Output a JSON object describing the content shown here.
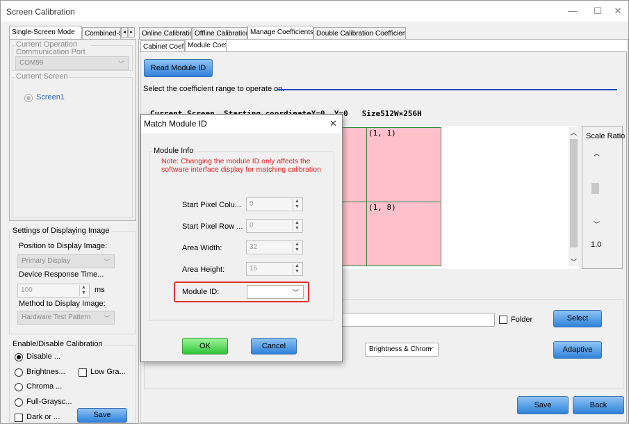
{
  "window": {
    "title": "Screen Calibration",
    "minimize": "—",
    "maximize": "☐",
    "close": "✕"
  },
  "left_tabs": [
    "Single-Screen Mode",
    "Combined-Sc"
  ],
  "left_tab_scroll": {
    "left": "◂",
    "right": "▸"
  },
  "left": {
    "comm_group_title": "Current Operation Communication Port",
    "comm_port": "COM99",
    "screen_group_title": "Current Screen",
    "screen_radio": "Screen1",
    "display_group_title": "Settings of Displaying Image",
    "position_label": "Position to Display Image:",
    "position_value": "Primary Display",
    "response_label": "Device Response Time...",
    "response_value": "100",
    "response_unit": "ms",
    "method_label": "Method to Display Image:",
    "method_value": "Hardware Test Pattern",
    "enable_group_title": "Enable/Disable Calibration",
    "opt_disable": "Disable ...",
    "opt_brightness": "Brightnes...",
    "opt_low_gray": "Low Gra...",
    "opt_chroma": "Chroma ...",
    "opt_full_gray": "Full-Graysc...",
    "opt_dark": "Dark or ...",
    "save": "Save"
  },
  "main_tabs": [
    "Online Calibration",
    "Offline Calibration",
    "Manage Coefficients",
    "Double Calibration Coefficients"
  ],
  "sub_tabs": [
    "Cabinet Coef",
    "Module Coef"
  ],
  "main": {
    "read_module_id": "Read Module ID",
    "range_label": "Select the coefficient range to operate on.",
    "screen_info": "Current Screen  Starting coordinateX=0, Y=0   Size512W×256H",
    "cells": [
      "(1, 1)",
      "(1, 8)"
    ],
    "scale_ratio_label": "Scale Ratio",
    "scale_ratio_value": "1.0",
    "folder_label": "Folder",
    "select": "Select",
    "brightness_combo": "Brightness & Chrom",
    "adaptive": "Adaptive",
    "save": "Save",
    "back": "Back"
  },
  "dialog": {
    "title": "Match Module ID",
    "close": "✕",
    "group_title": "Module Info",
    "note": "Note: Changing the module ID only affects the software interface display for matching calibration",
    "start_col_label": "Start Pixel Colu...",
    "start_col_value": "0",
    "start_row_label": "Start Pixel Row ...",
    "start_row_value": "0",
    "width_label": "Area Width:",
    "width_value": "32",
    "height_label": "Area Height:",
    "height_value": "16",
    "module_id_label": "Module ID:",
    "module_id_value": "",
    "ok": "OK",
    "cancel": "Cancel"
  },
  "colors": {
    "accent_blue": "#2e82da",
    "ok_green": "#2fc43a",
    "cell_pink": "#ffc0cb",
    "grid_green": "#2e8b3a",
    "note_red": "#e02020",
    "highlight_red": "#e03030"
  }
}
